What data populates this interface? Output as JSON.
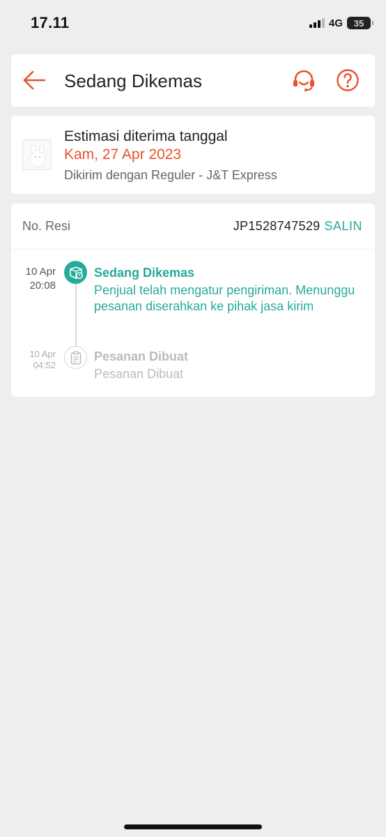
{
  "status_bar": {
    "time": "17.11",
    "network": "4G",
    "battery": "35"
  },
  "header": {
    "title": "Sedang Dikemas",
    "back_icon": "arrow-left-icon",
    "support_icon": "headset-icon",
    "help_icon": "question-circle-icon",
    "accent_color": "#e5532d"
  },
  "delivery": {
    "estimate_label": "Estimasi diterima tanggal",
    "estimate_date": "Kam, 27 Apr 2023",
    "courier_text": "Dikirim dengan Reguler - J&T Express"
  },
  "tracking": {
    "resi_label": "No. Resi",
    "resi_number": "JP1528747529",
    "copy_label": "SALIN",
    "accent_color": "#26aa99",
    "events": [
      {
        "date": "10 Apr",
        "time": "20:08",
        "title": "Sedang Dikemas",
        "description": "Penjual telah mengatur pengiriman. Menunggu pesanan diserahkan ke pihak jasa kirim",
        "icon": "package-clock-icon",
        "active": true
      },
      {
        "date": "10 Apr",
        "time": "04:52",
        "title": "Pesanan Dibuat",
        "description": "Pesanan Dibuat",
        "icon": "clipboard-icon",
        "active": false
      }
    ]
  }
}
